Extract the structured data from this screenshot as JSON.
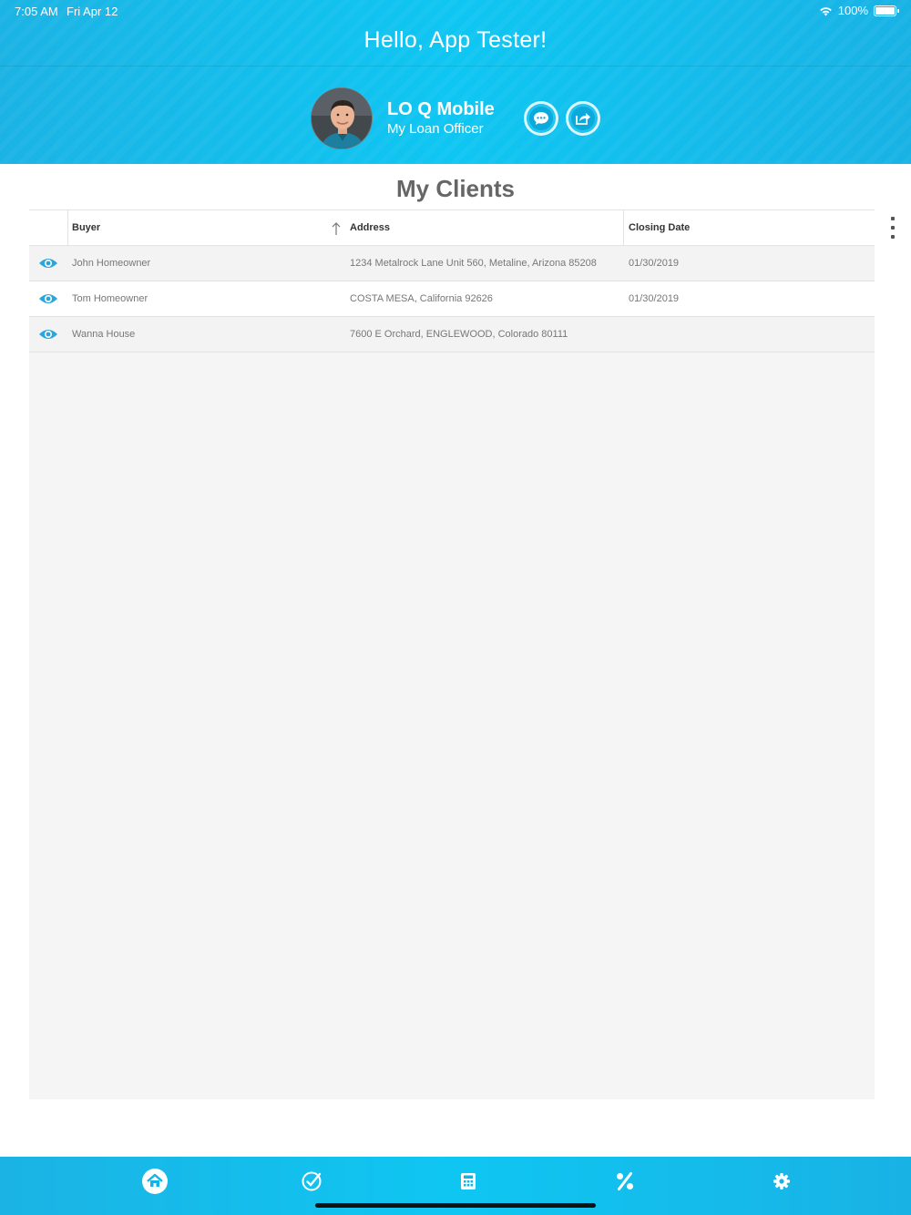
{
  "status_bar": {
    "time": "7:05 AM",
    "date": "Fri Apr 12",
    "battery": "100%",
    "wifi_icon": "wifi-icon",
    "battery_icon": "battery-icon"
  },
  "header": {
    "greeting": "Hello, App Tester!",
    "loan_officer": {
      "name": "LO Q Mobile",
      "role": "My Loan Officer",
      "avatar_icon": "avatar-photo"
    },
    "actions": [
      {
        "icon": "chat-icon"
      },
      {
        "icon": "share-icon"
      }
    ]
  },
  "page": {
    "title": "My Clients",
    "menu_icon": "kebab-menu-icon"
  },
  "table": {
    "columns": [
      "Buyer",
      "Address",
      "Closing Date"
    ],
    "sorted_by": "Buyer",
    "sort_direction": "ascending",
    "rows": [
      {
        "buyer": "John Homeowner",
        "address": "1234 Metalrock Lane Unit 560, Metaline, Arizona 85208",
        "closing_date": "01/30/2019"
      },
      {
        "buyer": "Tom Homeowner",
        "address": "COSTA MESA, California 92626",
        "closing_date": "01/30/2019"
      },
      {
        "buyer": "Wanna House",
        "address": "7600 E Orchard, ENGLEWOOD, Colorado 80111",
        "closing_date": ""
      }
    ]
  },
  "bottom_nav": {
    "items": [
      {
        "icon": "home-icon",
        "active": true
      },
      {
        "icon": "checkmark-icon",
        "active": false
      },
      {
        "icon": "calculator-icon",
        "active": false
      },
      {
        "icon": "percent-icon",
        "active": false
      },
      {
        "icon": "gear-icon",
        "active": false
      }
    ]
  },
  "colors": {
    "brand": "#0fc6f2",
    "eye_icon": "#2aa5dd",
    "title_text": "#666666"
  }
}
